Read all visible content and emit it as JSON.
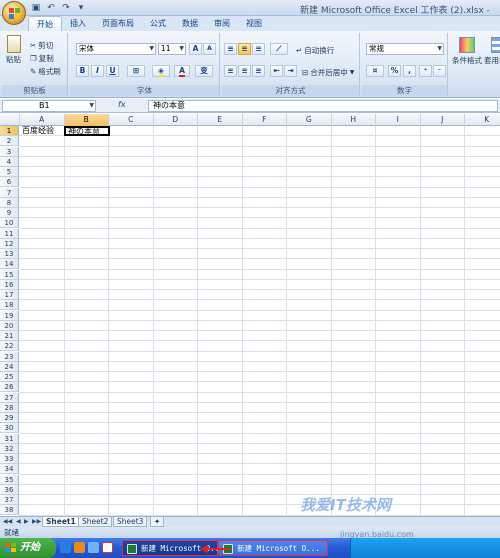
{
  "window": {
    "title": "新建 Microsoft Office Excel 工作表 (2).xlsx -",
    "qa_icons": [
      "save-icon",
      "undo-icon",
      "redo-icon",
      "customize-icon"
    ]
  },
  "tabs": [
    {
      "label": "开始",
      "active": true
    },
    {
      "label": "插入"
    },
    {
      "label": "页面布局"
    },
    {
      "label": "公式"
    },
    {
      "label": "数据"
    },
    {
      "label": "审阅"
    },
    {
      "label": "视图"
    }
  ],
  "ribbon": {
    "clipboard": {
      "label": "剪贴板",
      "paste": "粘贴",
      "cut": "剪切",
      "copy": "复制",
      "format_painter": "格式刷"
    },
    "font": {
      "label": "字体",
      "name": "宋体",
      "size": "11",
      "grow": "A",
      "shrink": "A",
      "bold": "B",
      "italic": "I",
      "underline": "U",
      "phonetic": "变"
    },
    "alignment": {
      "label": "对齐方式",
      "wrap": "自动换行",
      "merge": "合并后居中"
    },
    "number": {
      "label": "数字",
      "format": "常规",
      "percent": "%",
      "comma": ","
    },
    "styles": {
      "conditional": "条件格式",
      "table": "套用表格"
    }
  },
  "formula_bar": {
    "cell_ref": "B1",
    "fx": "fx",
    "content": "神の本意"
  },
  "grid": {
    "columns": [
      "A",
      "B",
      "C",
      "D",
      "E",
      "F",
      "G",
      "H",
      "I",
      "J",
      "K"
    ],
    "rows": [
      "1",
      "2",
      "3",
      "4",
      "5",
      "6",
      "7",
      "8",
      "9",
      "10",
      "11",
      "12",
      "13",
      "14",
      "15",
      "16",
      "17",
      "18",
      "19",
      "20",
      "21",
      "22",
      "23",
      "24",
      "25",
      "26",
      "27",
      "28",
      "29",
      "30",
      "31",
      "32",
      "33",
      "34",
      "35",
      "36",
      "37",
      "38"
    ],
    "cells": {
      "A1": "百度经验",
      "B1": "神の本意"
    },
    "selected": "B1"
  },
  "sheets": [
    {
      "label": "Sheet1",
      "active": true
    },
    {
      "label": "Sheet2"
    },
    {
      "label": "Sheet3"
    }
  ],
  "status": {
    "ready": "就绪"
  },
  "taskbar": {
    "start": "开始",
    "tasks": [
      "新建 Microsoft O...",
      "新建 Microsoft O..."
    ]
  },
  "watermark": {
    "text": "我爱IT技术网",
    "sub": "jingyan.baidu.com"
  },
  "colors": {
    "accent": "#2b579a",
    "selection": "#f1c15f",
    "excel_green": "#1d7a3a"
  }
}
